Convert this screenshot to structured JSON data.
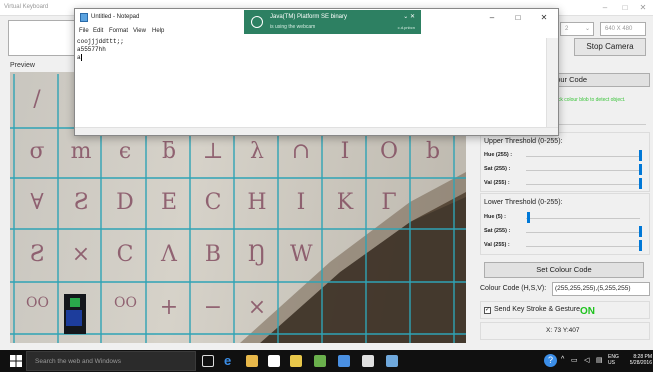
{
  "virtual_keyboard": {
    "title": "Virtual Keyboard",
    "combo_small_value": "2",
    "resolution_value": "640 X 480",
    "stop_camera_label": "Stop Camera",
    "preview_label": "Preview",
    "set_colour_code_top_label": "Colour Code",
    "hint_text": "Click colour blob to detect object.",
    "hsv_readout_top": "):",
    "upper_threshold_label": "Upper Threshold (0-255):",
    "upper_sliders": [
      {
        "label": "Hue (255) :",
        "value": 255
      },
      {
        "label": "Sat (255) :",
        "value": 255
      },
      {
        "label": "Val (255) :",
        "value": 255
      }
    ],
    "lower_threshold_label": "Lower Threshold (0-255):",
    "lower_sliders": [
      {
        "label": "Hue (5) :",
        "value": 5
      },
      {
        "label": "Sat (255) :",
        "value": 255
      },
      {
        "label": "Val (255) :",
        "value": 255
      }
    ],
    "set_colour_code_label": "Set Colour Code",
    "colour_code_label": "Colour Code (H,S,V):",
    "colour_code_value": "(255,255,255),(5,255,255)",
    "send_key_label": "Send Key Stroke & Gesture",
    "send_key_checked": true,
    "on_label": "ON",
    "coords_label": "X: 73 Y:407",
    "grid_letters": [
      [
        "/",
        "",
        "",
        "",
        "",
        "",
        "",
        "",
        "",
        ""
      ],
      [
        "σ",
        "m",
        "ϵ",
        "ƃ",
        "⊥",
        "λ",
        "∩",
        "I",
        "O",
        "b"
      ],
      [
        "∀",
        "Ƨ",
        "D",
        "E",
        "C",
        "H",
        "I",
        "K",
        "Γ",
        ""
      ],
      [
        "Ƨ",
        "×",
        "C",
        "Λ",
        "B",
        "Ŋ",
        "W",
        "",
        "",
        ""
      ],
      [
        "OO",
        "",
        "OO",
        "+",
        "−",
        "×",
        "",
        "",
        "",
        ""
      ]
    ]
  },
  "notepad": {
    "title": "Untitled - Notepad",
    "menu": [
      "File",
      "Edit",
      "Format",
      "View",
      "Help"
    ],
    "lines": [
      "coojjjddttt;;",
      "a55577hh",
      "a"
    ]
  },
  "toast": {
    "title": "Java(TM) Platform SE binary",
    "body": "is using the webcam",
    "count": "c.d.pnbcn"
  },
  "taskbar": {
    "search_placeholder": "Search the web and Windows",
    "lang": "ENG",
    "region": "US",
    "time": "8:28 PM",
    "date": "5/28/2016"
  },
  "colors": {
    "toast_bg": "#2d8062",
    "grid_line": "#2fa3b5",
    "on_green": "#1ec21e",
    "slider_blue": "#0078d7"
  }
}
